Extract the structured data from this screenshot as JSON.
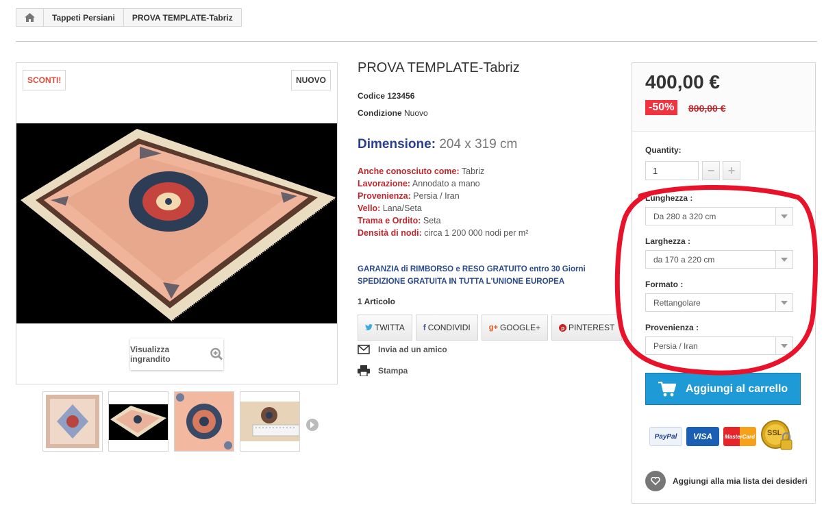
{
  "breadcrumb": {
    "home_icon": "home-icon",
    "items": [
      "Tappeti Persiani",
      "PROVA TEMPLATE-Tabriz"
    ]
  },
  "badges": {
    "sale": "SCONTI!",
    "new": "NUOVO"
  },
  "zoom_label": "Visualizza ingrandito",
  "product": {
    "title": "PROVA TEMPLATE-Tabriz",
    "code_label": "Codice",
    "code_value": "123456",
    "condition_label": "Condizione",
    "condition_value": "Nuovo",
    "dimension_label": "Dimensione:",
    "dimension_value": "204 x 319 cm",
    "attributes": [
      {
        "label": "Anche conosciuto come:",
        "value": "Tabriz"
      },
      {
        "label": "Lavorazione:",
        "value": "Annodato a mano"
      },
      {
        "label": "Provenienza:",
        "value": "Persia / Iran"
      },
      {
        "label": "Vello:",
        "value": "Lana/Seta"
      },
      {
        "label": "Trama e Ordito:",
        "value": "Seta"
      },
      {
        "label": "Densità di nodi:",
        "value": "circa 1 200 000 nodi per m²"
      }
    ],
    "guarantee_1": "GARANZIA di RIMBORSO e RESO GRATUITO entro 30 Giorni",
    "guarantee_2": "SPEDIZIONE GRATUITA IN TUTTA L'UNIONE EUROPEA",
    "articles": "1 Articolo"
  },
  "social": {
    "twitter": "TWITTA",
    "facebook": "CONDIVIDI",
    "google": "GOOGLE+",
    "pinterest": "PINTEREST"
  },
  "actions": {
    "send_friend": "Invia ad un amico",
    "print": "Stampa"
  },
  "buybox": {
    "price": "400,00 €",
    "discount": "-50%",
    "old_price": "800,00 €",
    "quantity_label": "Quantity:",
    "quantity_value": "1",
    "options": [
      {
        "label": "Lunghezza :",
        "value": "Da 280 a 320 cm"
      },
      {
        "label": "Larghezza :",
        "value": "da 170 a 220 cm"
      },
      {
        "label": "Formato :",
        "value": "Rettangolare"
      },
      {
        "label": "Provenienza :",
        "value": "Persia / Iran"
      }
    ],
    "add_to_cart": "Aggiungi al carrello",
    "payments": [
      "PayPal",
      "VISA",
      "MasterCard",
      "SSL"
    ],
    "wishlist": "Aggiungi alla mia lista dei desideri"
  },
  "colors": {
    "accent_blue": "#1e9ad6",
    "sale_red": "#f13340",
    "label_red": "#c0272d",
    "dimension_blue": "#2a3f8f",
    "annotation_red": "#e8122a"
  }
}
